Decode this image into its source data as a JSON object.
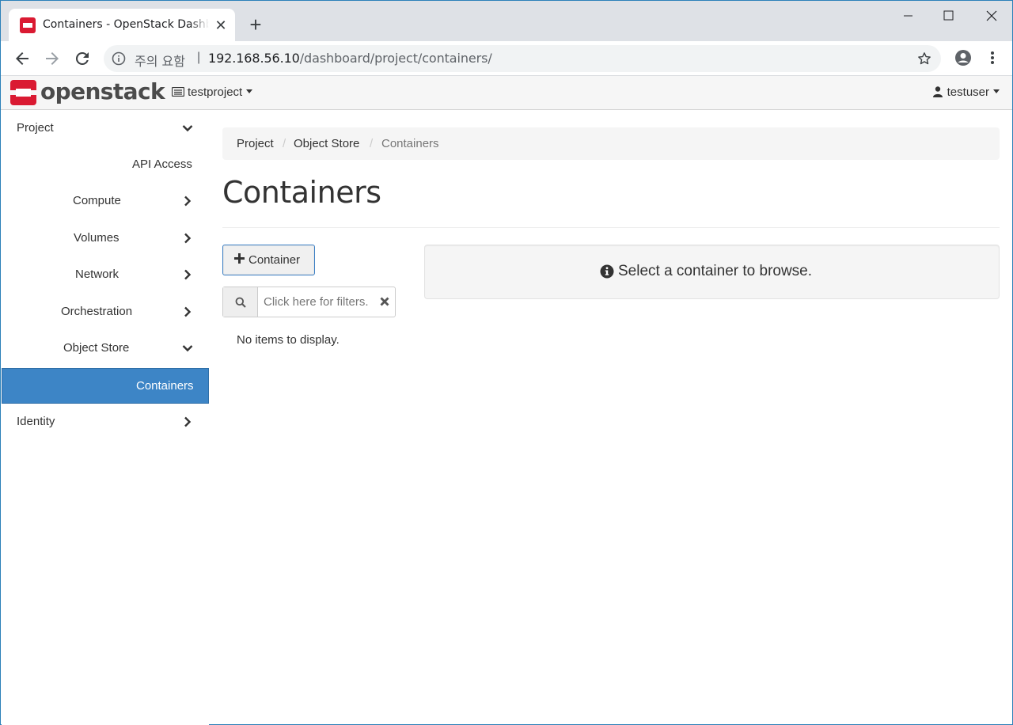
{
  "browser": {
    "tab_title": "Containers - OpenStack Dashboard",
    "url_warning": "주의 요함",
    "url_separator": "|",
    "url_host": "192.168.56.10",
    "url_path": "/dashboard/project/containers/"
  },
  "navbar": {
    "logo_text": "openstack",
    "project": "testproject",
    "user": "testuser"
  },
  "sidebar": {
    "items": [
      {
        "label": "Project"
      },
      {
        "label": "API Access"
      },
      {
        "label": "Compute"
      },
      {
        "label": "Volumes"
      },
      {
        "label": "Network"
      },
      {
        "label": "Orchestration"
      },
      {
        "label": "Object Store"
      },
      {
        "label": "Containers"
      },
      {
        "label": "Identity"
      }
    ]
  },
  "breadcrumb": [
    "Project",
    "/",
    "Object Store",
    "/",
    "Containers"
  ],
  "main": {
    "title": "Containers",
    "add_button": "Container",
    "filter_placeholder": "Click here for filters.",
    "no_items": "No items to display.",
    "info_message": "Select a container to browse."
  },
  "colors": {
    "accent": "#3d85c6",
    "logo_red": "#da1a32"
  }
}
